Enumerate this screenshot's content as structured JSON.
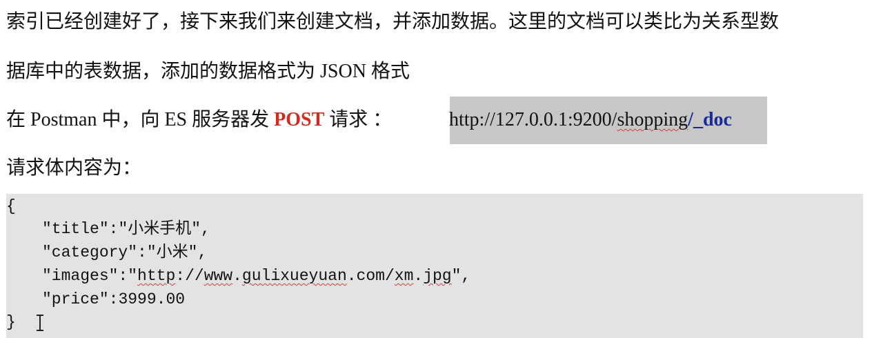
{
  "doc": {
    "para1": "索引已经创建好了，接下来我们来创建文档，并添加数据。这里的文档可以类比为关系型数",
    "para2": "据库中的表数据，添加的数据格式为 JSON 格式",
    "para3": {
      "prefix": "在  Postman 中，向 ES 服务器发 ",
      "method": "POST",
      "suffix": " 请求  ：",
      "url_base": "http://127.0.0.1:9200/",
      "url_index": "shopping",
      "url_slash": "/",
      "url_doc": "_doc"
    },
    "para4": "请求体内容为："
  },
  "code": {
    "open": "{",
    "title_key": "\"title\"",
    "title_value": "\"小米手机\"",
    "category_key": "\"category\"",
    "category_value": "\"小米\"",
    "images_key": "\"images\"",
    "images_q1": "\"",
    "images_w1": "http",
    "images_w2": "://",
    "images_w3": "www",
    "images_w4": ".",
    "images_w5": "gulixueyuan",
    "images_w6": ".com/",
    "images_w7": "xm",
    "images_w8": ".",
    "images_w9": "jpg",
    "images_q2": "\"",
    "price_key": "\"price\"",
    "price_value": "3999.00",
    "close": "}"
  },
  "colors": {
    "post": "#d42a1e",
    "doc_link": "#1a2a9c",
    "url_highlight": "#c7c7c7",
    "code_bg": "#e3e3e3",
    "spell_underline": "#d43b3b"
  },
  "icons": {
    "cursor": "text-cursor-icon"
  }
}
